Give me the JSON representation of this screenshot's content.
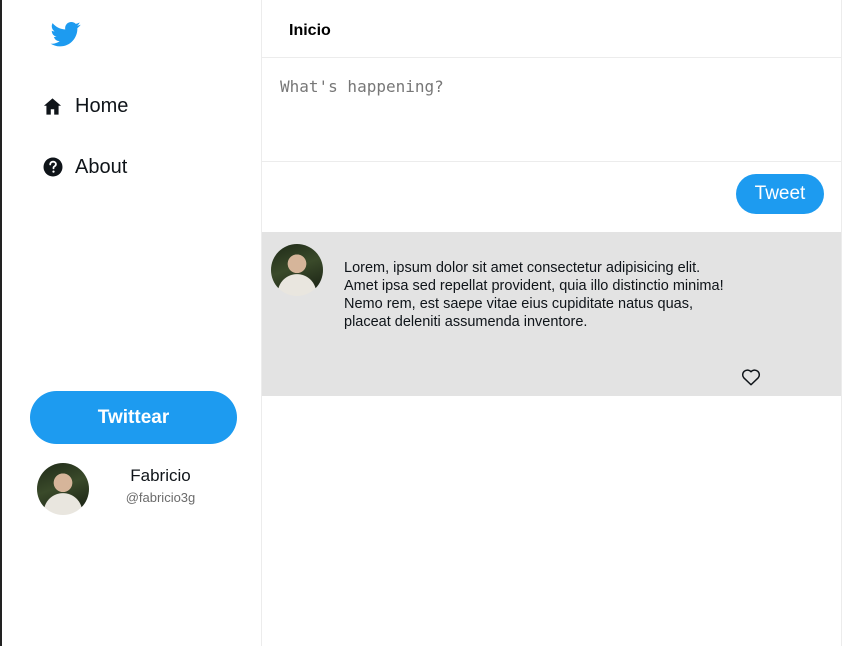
{
  "sidebar": {
    "logo_icon": "twitter-bird-icon",
    "items": [
      {
        "label": "Home",
        "icon": "home-icon"
      },
      {
        "label": "About",
        "icon": "question-circle-icon"
      }
    ],
    "twittear_label": "Twittear",
    "profile": {
      "name": "Fabricio",
      "handle": "@fabricio3g"
    }
  },
  "header": {
    "title": "Inicio"
  },
  "compose": {
    "placeholder": "What's happening?",
    "tweet_label": "Tweet"
  },
  "feed": {
    "tweets": [
      {
        "text": "Lorem, ipsum dolor sit amet consectetur adipisicing elit. Amet ipsa sed repellat provident, quia illo distinctio minima! Nemo rem, est saepe vitae eius cupiditate natus quas, placeat deleniti assumenda inventore.",
        "like_icon": "heart-outline-icon"
      }
    ]
  },
  "colors": {
    "accent": "#1d9bf0",
    "tweet_background": "#e3e3e3"
  }
}
